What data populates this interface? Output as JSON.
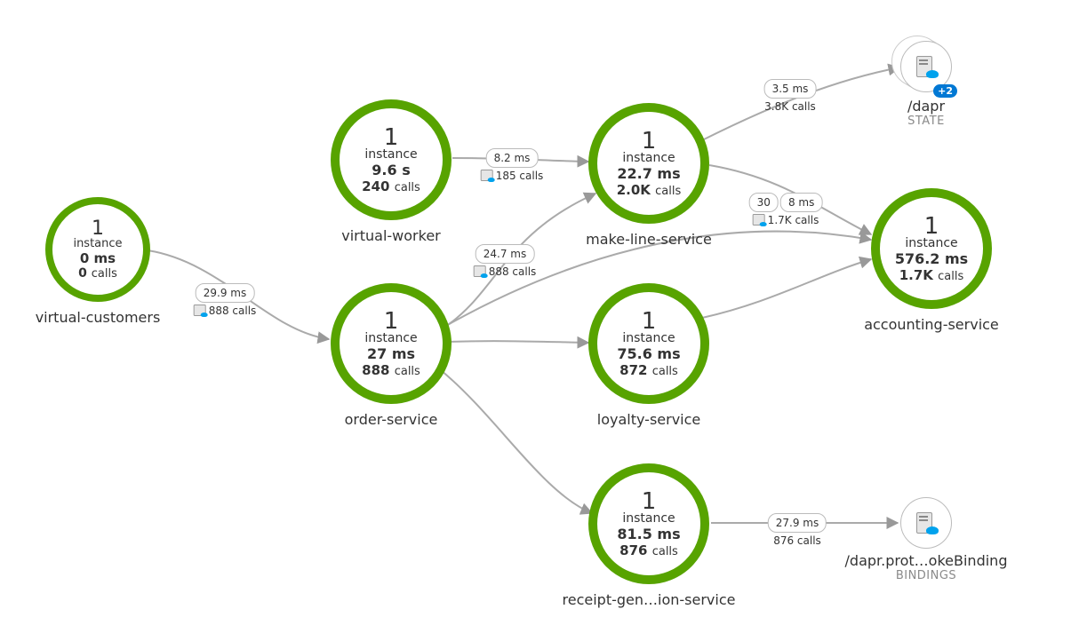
{
  "nodes": {
    "virtual_customers": {
      "count": "1",
      "instance": "instance",
      "latency": "0 ms",
      "calls_n": "0",
      "calls_suffix": "calls",
      "label": "virtual-customers"
    },
    "virtual_worker": {
      "count": "1",
      "instance": "instance",
      "latency": "9.6 s",
      "calls_n": "240",
      "calls_suffix": "calls",
      "label": "virtual-worker"
    },
    "order_service": {
      "count": "1",
      "instance": "instance",
      "latency": "27 ms",
      "calls_n": "888",
      "calls_suffix": "calls",
      "label": "order-service"
    },
    "make_line_service": {
      "count": "1",
      "instance": "instance",
      "latency": "22.7 ms",
      "calls_n": "2.0",
      "calls_unit": "K",
      "calls_suffix": "calls",
      "label": "make-line-service"
    },
    "loyalty_service": {
      "count": "1",
      "instance": "instance",
      "latency": "75.6 ms",
      "calls_n": "872",
      "calls_suffix": "calls",
      "label": "loyalty-service"
    },
    "accounting_service": {
      "count": "1",
      "instance": "instance",
      "latency": "576.2 ms",
      "calls_n": "1.7",
      "calls_unit": "K",
      "calls_suffix": "calls",
      "label": "accounting-service"
    },
    "receipt_service": {
      "count": "1",
      "instance": "instance",
      "latency": "81.5 ms",
      "calls_n": "876",
      "calls_suffix": "calls",
      "label": "receipt-gen…ion-service"
    }
  },
  "deps": {
    "dapr_state": {
      "label": "/dapr",
      "sublabel": "STATE",
      "badge": "+2"
    },
    "dapr_binding": {
      "label": "/dapr.prot…okeBinding",
      "sublabel": "BINDINGS"
    }
  },
  "edges": {
    "vc_to_order": {
      "latency": "29.9 ms",
      "calls": "888 calls"
    },
    "vw_to_makeline": {
      "latency": "8.2 ms",
      "calls": "185 calls"
    },
    "order_to_makeline": {
      "latency": "24.7 ms",
      "calls": "888 calls"
    },
    "makeline_to_state": {
      "latency": "3.5 ms",
      "calls": "3.8K calls"
    },
    "makeline_to_accounting_1": {
      "latency": "30"
    },
    "makeline_to_accounting_2": {
      "latency": "8 ms",
      "calls": "1.7K calls"
    },
    "receipt_to_binding": {
      "latency": "27.9 ms",
      "calls": "876 calls"
    }
  }
}
